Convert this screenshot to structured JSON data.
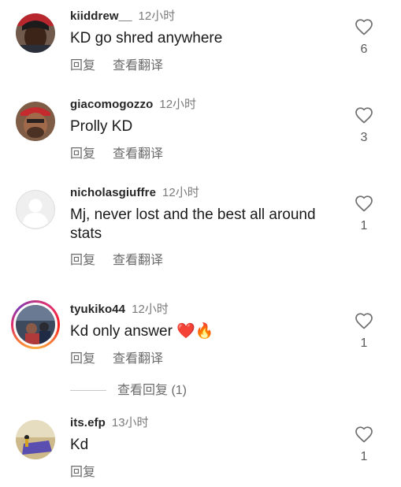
{
  "comments": [
    {
      "username": "kiiddrew__",
      "time": "12小时",
      "text": "KD go shred anywhere",
      "reply_label": "回复",
      "translate_label": "查看翻译",
      "likes": "6"
    },
    {
      "username": "giacomogozzo",
      "time": "12小时",
      "text": "Prolly KD",
      "reply_label": "回复",
      "translate_label": "查看翻译",
      "likes": "3"
    },
    {
      "username": "nicholasgiuffre",
      "time": "12小时",
      "text": "Mj, never lost and the best all around stats",
      "reply_label": "回复",
      "translate_label": "查看翻译",
      "likes": "1"
    },
    {
      "username": "tyukiko44",
      "time": "12小时",
      "text": "Kd only answer",
      "emoji_heart": "❤️",
      "emoji_fire": "🔥",
      "reply_label": "回复",
      "translate_label": "查看翻译",
      "likes": "1",
      "view_replies": "查看回复 (1)"
    },
    {
      "username": "its.efp",
      "time": "13小时",
      "text": "Kd",
      "reply_label": "回复",
      "likes": "1"
    }
  ],
  "icons": {
    "like": "heart-outline-icon",
    "default_avatar": "default-avatar-icon"
  },
  "colors": {
    "story_ring": "#e1306c",
    "muted_text": "#7a7a7a",
    "heart_emoji": "#e0202e"
  }
}
